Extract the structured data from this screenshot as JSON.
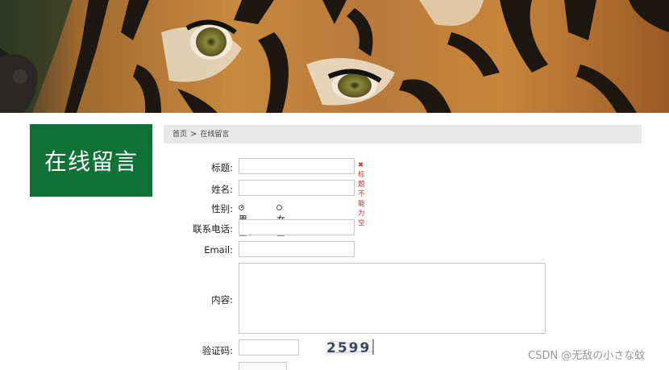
{
  "banner": {
    "alt": "tiger"
  },
  "sidebar": {
    "title": "在线留言"
  },
  "breadcrumb": {
    "home": "首页",
    "separator": ">",
    "current": "在线留言"
  },
  "form": {
    "title_label": "标题:",
    "title_value": "",
    "title_error": "标题不能为空",
    "name_label": "姓名:",
    "name_value": "",
    "gender_label": "性别:",
    "gender_options": [
      "男士",
      "女士"
    ],
    "gender_selected": "男士",
    "phone_label": "联系电话:",
    "phone_value": "",
    "email_label": "Email:",
    "email_value": "",
    "content_label": "内容:",
    "content_value": "",
    "captcha_label": "验证码:",
    "captcha_value": "",
    "captcha_text": "2599"
  },
  "watermark": "CSDN @无敌の小さな蚊",
  "colors": {
    "sidebar_bg": "#0e7236",
    "breadcrumb_bg": "#e8e8e8",
    "error": "#c0392b"
  }
}
